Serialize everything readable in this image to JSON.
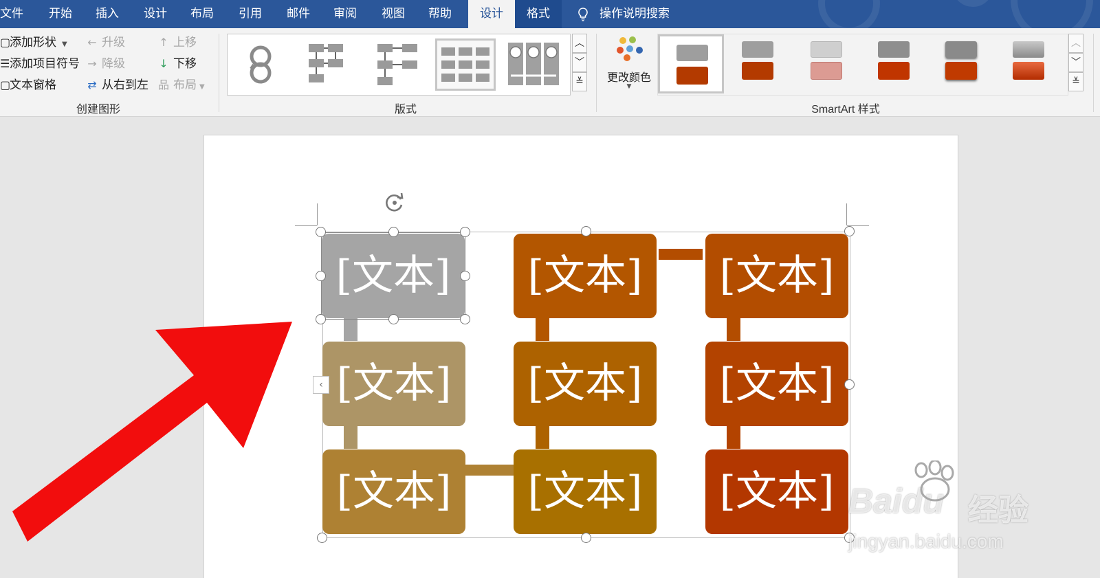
{
  "tabs": [
    {
      "label": "文件"
    },
    {
      "label": "开始"
    },
    {
      "label": "插入"
    },
    {
      "label": "设计"
    },
    {
      "label": "布局"
    },
    {
      "label": "引用"
    },
    {
      "label": "邮件"
    },
    {
      "label": "审阅"
    },
    {
      "label": "视图"
    },
    {
      "label": "帮助"
    },
    {
      "label": "设计"
    },
    {
      "label": "格式"
    }
  ],
  "active_tab_index": 10,
  "tell_me": {
    "label": "操作说明搜索",
    "icon": "lightbulb-icon"
  },
  "groups": {
    "create_graphic": {
      "label": "创建图形",
      "add_shape": "添加形状",
      "add_bullet": "添加项目符号",
      "text_pane": "文本窗格",
      "promote": "升级",
      "demote": "降级",
      "right_to_left": "从右到左",
      "move_up": "上移",
      "move_down": "下移",
      "layout": "布局"
    },
    "layouts": {
      "label": "版式",
      "selected_index": 3
    },
    "smartart_styles": {
      "label": "SmartArt 样式",
      "change_colors": "更改颜色",
      "selected_index": 0
    }
  },
  "smartart": {
    "boxes": [
      {
        "text": "[文本]",
        "color": "#a5a5a5"
      },
      {
        "text": "[文本]",
        "color": "#b35600"
      },
      {
        "text": "[文本]",
        "color": "#b34d00"
      },
      {
        "text": "[文本]",
        "color": "#ad9566"
      },
      {
        "text": "[文本]",
        "color": "#ad6200"
      },
      {
        "text": "[文本]",
        "color": "#b34300"
      },
      {
        "text": "[文本]",
        "color": "#ae8133"
      },
      {
        "text": "[文本]",
        "color": "#a87000"
      },
      {
        "text": "[文本]",
        "color": "#b33700"
      }
    ]
  },
  "watermark": {
    "brand": "Bai",
    "brand2": "du",
    "brand_cn": "经验",
    "url": "jingyan.baidu.com"
  },
  "colors": {
    "ribbon_blue": "#2b579a",
    "ribbon_bg": "#f3f3f3",
    "arrow_red": "#f20d0d"
  }
}
